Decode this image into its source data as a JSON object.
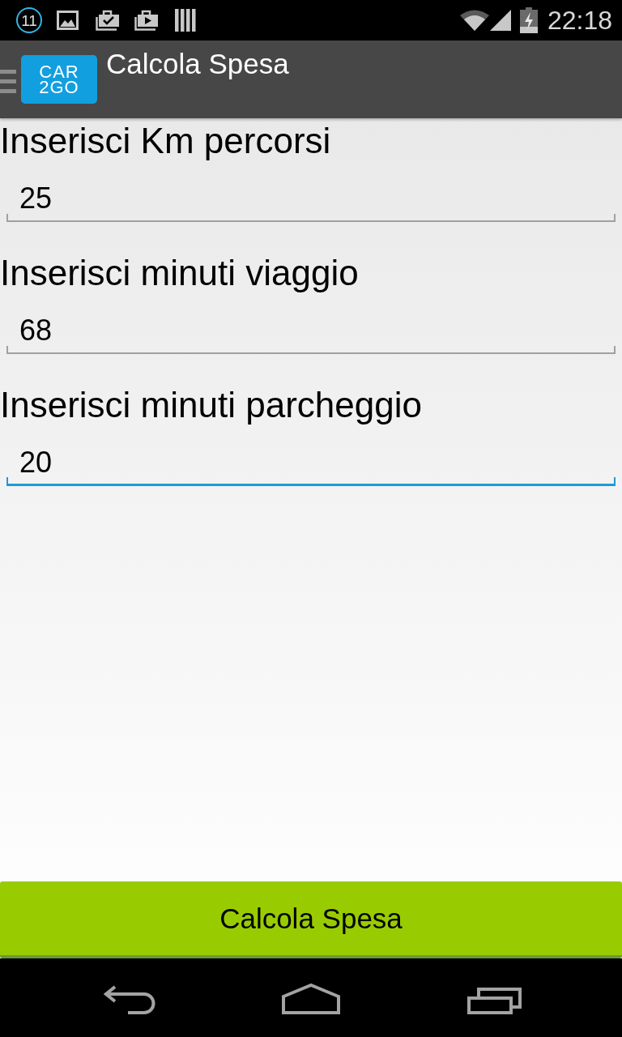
{
  "status_bar": {
    "notification_count": "11",
    "time": "22:18"
  },
  "action_bar": {
    "logo_lines": [
      "CAR",
      "2GO"
    ],
    "title": "Calcola Spesa"
  },
  "fields": [
    {
      "label": "Inserisci Km percorsi",
      "value": "25",
      "focused": false
    },
    {
      "label": "Inserisci minuti viaggio",
      "value": "68",
      "focused": false
    },
    {
      "label": "Inserisci minuti parcheggio",
      "value": "20",
      "focused": true
    }
  ],
  "button": {
    "label": "Calcola Spesa"
  }
}
